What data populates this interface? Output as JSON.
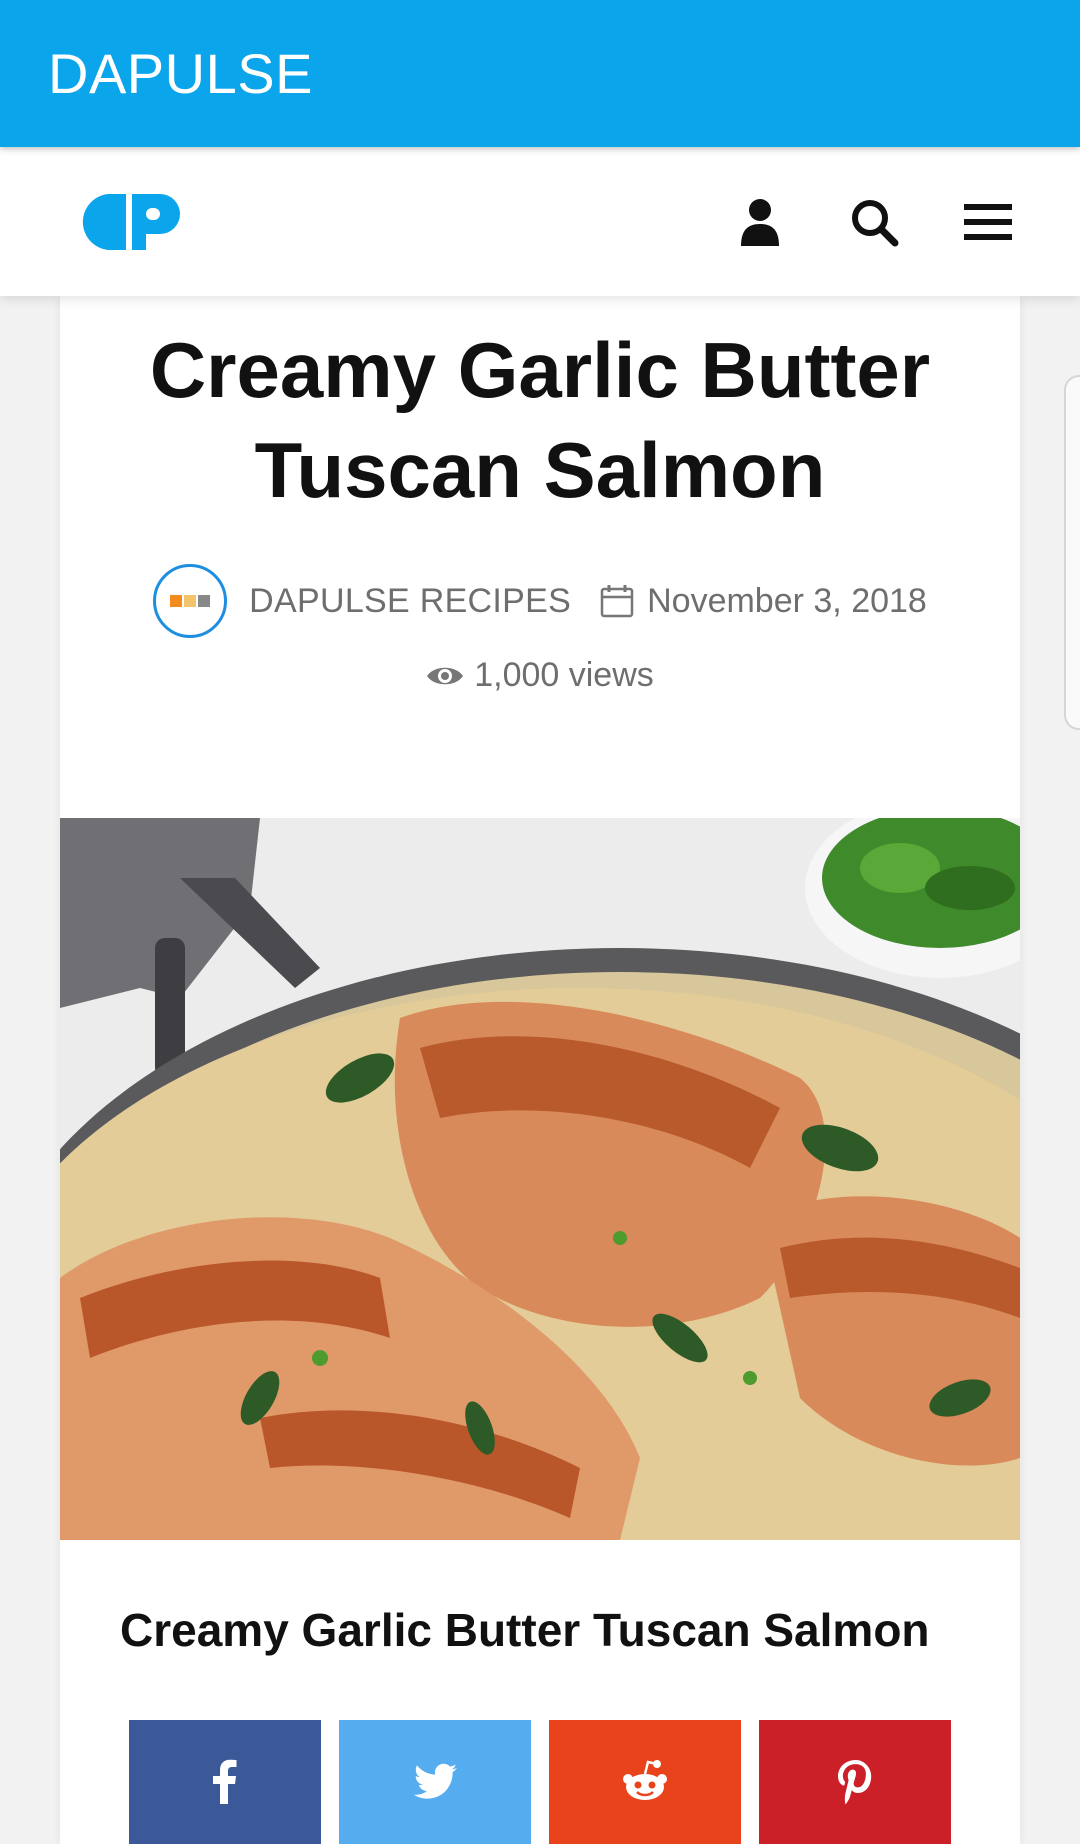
{
  "app_bar": {
    "title": "DAPULSE"
  },
  "header": {
    "logo_icon": "dapulse-logo",
    "actions": [
      {
        "name": "user-icon"
      },
      {
        "name": "search-icon"
      },
      {
        "name": "menu-icon"
      }
    ]
  },
  "article": {
    "title": "Creamy Garlic Butter Tuscan Salmon",
    "author": "DAPULSE RECIPES",
    "date": "November 3, 2018",
    "views": "1,000 views",
    "image_alt_icon": "salmon-photo",
    "subtitle": "Creamy Garlic Butter Tuscan Salmon"
  },
  "share": [
    {
      "network": "facebook",
      "icon": "facebook-icon",
      "color": "#3b5998"
    },
    {
      "network": "twitter",
      "icon": "twitter-icon",
      "color": "#55acee"
    },
    {
      "network": "reddit",
      "icon": "reddit-icon",
      "color": "#ff4500"
    },
    {
      "network": "pinterest",
      "icon": "pinterest-icon",
      "color": "#cb2027"
    }
  ],
  "colors": {
    "app_bar": "#0ba5ec",
    "accent": "#1e8fe0",
    "meta_text": "#6e6e6e"
  }
}
